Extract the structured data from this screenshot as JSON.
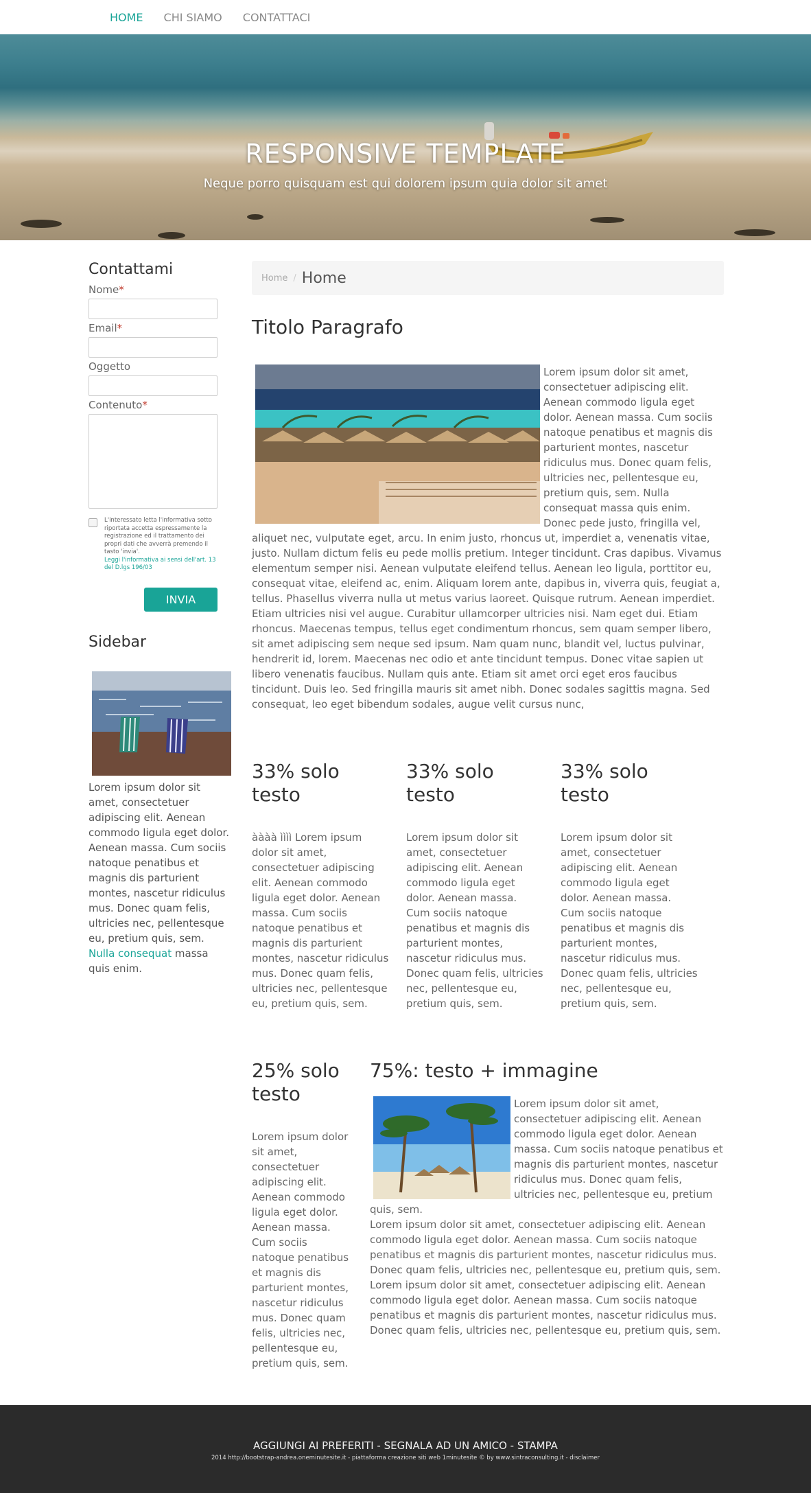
{
  "nav": {
    "items": [
      {
        "label": "HOME",
        "active": true
      },
      {
        "label": "CHI SIAMO",
        "active": false
      },
      {
        "label": "CONTATTACI",
        "active": false
      }
    ],
    "accent": "#19a497"
  },
  "hero": {
    "title": "RESPONSIVE TEMPLATE",
    "subtitle": "Neque porro quisquam est qui dolorem ipsum quia dolor sit amet"
  },
  "contact": {
    "heading": "Contattami",
    "name_label": "Nome",
    "email_label": "Email",
    "subject_label": "Oggetto",
    "content_label": "Contenuto",
    "required_mark": "*",
    "consent_text": "L'interessato letta l'informativa sotto riportata accetta espressamente la registrazione ed il trattamento dei propri dati che avverrà premendo il tasto 'invia'.",
    "consent_link": "Leggi l'informativa ai sensi dell'art. 13 del D.lgs 196/03",
    "submit_label": "INVIA"
  },
  "sidebar": {
    "heading": "Sidebar",
    "text": "Lorem ipsum dolor sit amet, consectetuer adipiscing elit. Aenean commodo ligula eget dolor. Aenean massa. Cum sociis natoque penatibus et magnis dis parturient montes, nascetur ridiculus mus. Donec quam felis, ultricies nec, pellentesque eu, pretium quis, sem.",
    "link": "Nulla consequat",
    "text_after": "massa quis enim."
  },
  "breadcrumb": {
    "home": "Home",
    "separator": "/",
    "current": "Home"
  },
  "main": {
    "title": "Titolo Paragrafo",
    "paragraph": "Lorem ipsum dolor sit amet, consectetuer adipiscing elit. Aenean commodo ligula eget dolor. Aenean massa. Cum sociis natoque penatibus et magnis dis parturient montes, nascetur ridiculus mus. Donec quam felis, ultricies nec, pellentesque eu, pretium quis, sem. Nulla consequat massa quis enim. Donec pede justo, fringilla vel, aliquet nec, vulputate eget, arcu. In enim justo, rhoncus ut, imperdiet a, venenatis vitae, justo. Nullam dictum felis eu pede mollis pretium. Integer tincidunt. Cras dapibus. Vivamus elementum semper nisi. Aenean vulputate eleifend tellus. Aenean leo ligula, porttitor eu, consequat vitae, eleifend ac, enim. Aliquam lorem ante, dapibus in, viverra quis, feugiat a, tellus. Phasellus viverra nulla ut metus varius laoreet. Quisque rutrum. Aenean imperdiet. Etiam ultricies nisi vel augue. Curabitur ullamcorper ultricies nisi. Nam eget dui. Etiam rhoncus. Maecenas tempus, tellus eget condimentum rhoncus, sem quam semper libero, sit amet adipiscing sem neque sed ipsum. Nam quam nunc, blandit vel, luctus pulvinar, hendrerit id, lorem. Maecenas nec odio et ante tincidunt tempus. Donec vitae sapien ut libero venenatis faucibus. Nullam quis ante. Etiam sit amet orci eget eros faucibus tincidunt. Duis leo. Sed fringilla mauris sit amet nibh. Donec sodales sagittis magna. Sed consequat, leo eget bibendum sodales, augue velit cursus nunc,"
  },
  "cols33": [
    {
      "heading": "33% solo testo",
      "text": "àààà ìììì Lorem ipsum dolor sit amet, consectetuer adipiscing elit. Aenean commodo ligula eget dolor. Aenean massa. Cum sociis natoque penatibus et magnis dis parturient montes, nascetur ridiculus mus. Donec quam felis, ultricies nec, pellentesque eu, pretium quis, sem."
    },
    {
      "heading": "33% solo testo",
      "text": "Lorem ipsum dolor sit amet, consectetuer adipiscing elit. Aenean commodo ligula eget dolor. Aenean massa. Cum sociis natoque penatibus et magnis dis parturient montes, nascetur ridiculus mus. Donec quam felis, ultricies nec, pellentesque eu, pretium quis, sem."
    },
    {
      "heading": "33% solo testo",
      "text": "Lorem ipsum dolor sit amet, consectetuer adipiscing elit. Aenean commodo ligula eget dolor. Aenean massa. Cum sociis natoque penatibus et magnis dis parturient montes, nascetur ridiculus mus. Donec quam felis, ultricies nec, pellentesque eu, pretium quis, sem."
    }
  ],
  "col25": {
    "heading": "25% solo testo",
    "text": "Lorem ipsum dolor sit amet, consectetuer adipiscing elit. Aenean commodo ligula eget dolor. Aenean massa. Cum sociis natoque penatibus et magnis dis parturient montes, nascetur ridiculus mus. Donec quam felis, ultricies nec, pellentesque eu, pretium quis, sem."
  },
  "col75": {
    "heading": "75%: testo + immagine",
    "text1": "Lorem ipsum dolor sit amet, consectetuer adipiscing elit. Aenean commodo ligula eget dolor. Aenean massa. Cum sociis natoque penatibus et magnis dis parturient montes, nascetur ridiculus mus. Donec quam felis, ultricies nec, pellentesque eu, pretium quis, sem.",
    "text2": "Lorem ipsum dolor sit amet, consectetuer adipiscing elit. Aenean commodo ligula eget dolor. Aenean massa. Cum sociis natoque penatibus et magnis dis parturient montes, nascetur ridiculus mus. Donec quam felis, ultricies nec, pellentesque eu, pretium quis, sem. Lorem ipsum dolor sit amet, consectetuer adipiscing elit. Aenean commodo ligula eget dolor. Aenean massa. Cum sociis natoque penatibus et magnis dis parturient montes, nascetur ridiculus mus. Donec quam felis, ultricies nec, pellentesque eu, pretium quis, sem."
  },
  "footer": {
    "links": "AGGIUNGI AI PREFERITI - SEGNALA AD UN AMICO - STAMPA",
    "small": "2014 http://bootstrap-andrea.oneminutesite.it - piattaforma creazione siti web 1minutesite © by www.sintraconsulting.it - disclaimer"
  }
}
